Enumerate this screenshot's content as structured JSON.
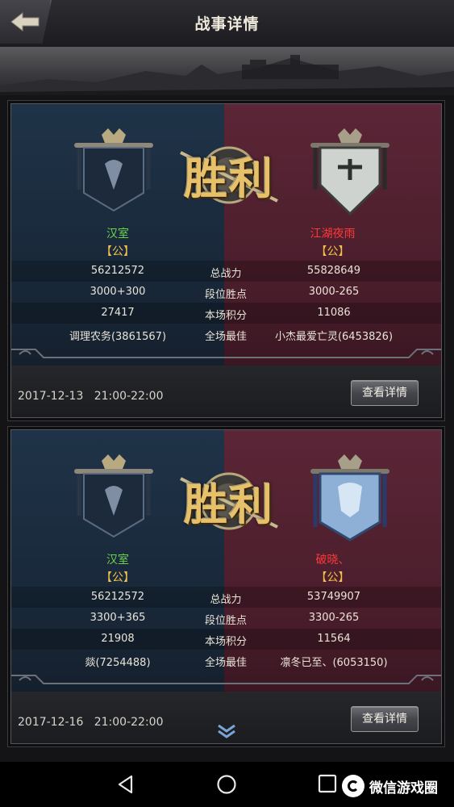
{
  "header": {
    "title": "战事详情"
  },
  "battles": [
    {
      "result": "胜利",
      "left": {
        "name": "汉室",
        "tag": "【公】",
        "total_power": "56212572",
        "rank_base": "3000",
        "rank_delta": "+300",
        "score": "27417",
        "mvp": "调理农务(3861567)"
      },
      "right": {
        "name": "江湖夜雨",
        "tag": "【公】",
        "total_power": "55828649",
        "rank_base": "3000",
        "rank_delta": "-265",
        "score": "11086",
        "mvp": "小杰最爱亡灵(6453826)"
      },
      "labels": {
        "total_power": "总战力",
        "rank_points": "段位胜点",
        "score": "本场积分",
        "mvp": "全场最佳"
      },
      "date": "2017-12-13",
      "time": "21:00-22:00",
      "details_label": "查看详情"
    },
    {
      "result": "胜利",
      "left": {
        "name": "汉室",
        "tag": "【公】",
        "total_power": "56212572",
        "rank_base": "3300",
        "rank_delta": "+365",
        "score": "21908",
        "mvp": "燚(7254488)"
      },
      "right": {
        "name": "破晓、",
        "tag": "【公】",
        "total_power": "53749907",
        "rank_base": "3300",
        "rank_delta": "-265",
        "score": "11564",
        "mvp": "凛冬已至、(6053150)"
      },
      "labels": {
        "total_power": "总战力",
        "rank_points": "段位胜点",
        "score": "本场积分",
        "mvp": "全场最佳"
      },
      "date": "2017-12-16",
      "time": "21:00-22:00",
      "details_label": "查看详情"
    }
  ],
  "watermark": {
    "text": "微信游戏圈"
  },
  "icons": {
    "back": "back-arrow-icon",
    "scroll": "double-chevron-down-icon",
    "nav_back": "triangle-back-icon",
    "nav_home": "circle-home-icon",
    "nav_recent": "square-recent-icon"
  },
  "colors": {
    "winner_name": "#6cd24a",
    "loser_name": "#ff3838",
    "tag": "#f0c44c",
    "left_side": "#1f3348",
    "right_side": "#5b2637"
  }
}
